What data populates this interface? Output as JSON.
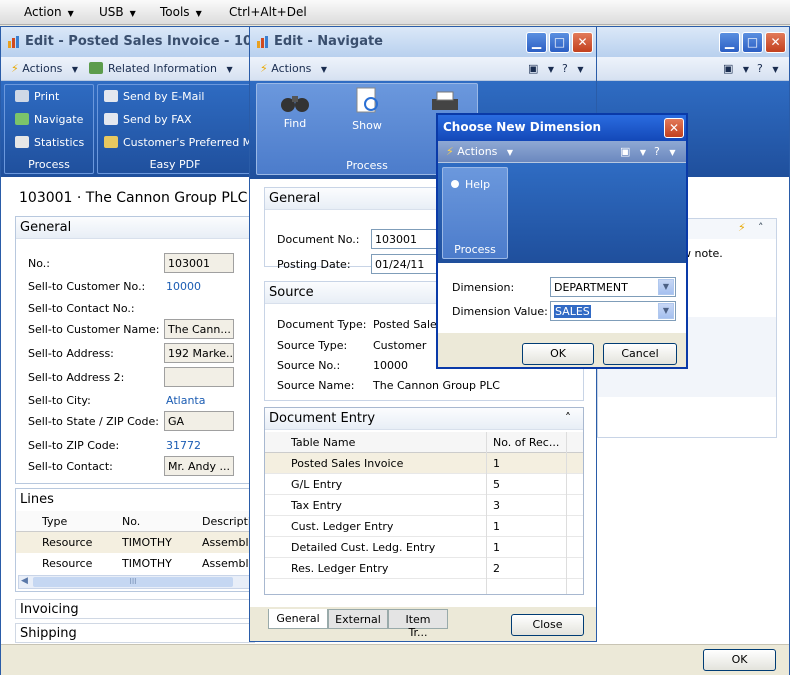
{
  "host_menu": {
    "action": "Action",
    "usb": "USB",
    "tools": "Tools",
    "cad": "Ctrl+Alt+Del"
  },
  "invoice_window": {
    "title": "Edit - Posted Sales Invoice - 103001",
    "actions": "Actions",
    "related": "Related Information",
    "ribbon": {
      "process": {
        "label": "Process",
        "items": [
          "Print",
          "Navigate",
          "Statistics"
        ]
      },
      "easy_pdf": {
        "label": "Easy PDF",
        "items": [
          "Send by E-Mail",
          "Send by FAX",
          "Customer's Preferred Met"
        ]
      }
    },
    "heading": "103001 · The Cannon Group PLC",
    "general": {
      "title": "General",
      "fields": [
        {
          "label": "No.:",
          "value": "103001",
          "kind": "box"
        },
        {
          "label": "Sell-to Customer No.:",
          "value": "10000",
          "kind": "link"
        },
        {
          "label": "Sell-to Contact No.:",
          "value": "",
          "kind": "none"
        },
        {
          "label": "Sell-to Customer Name:",
          "value": "The Cann...",
          "kind": "box"
        },
        {
          "label": "Sell-to Address:",
          "value": "192 Marke...",
          "kind": "box"
        },
        {
          "label": "Sell-to Address 2:",
          "value": "",
          "kind": "box"
        },
        {
          "label": "Sell-to City:",
          "value": "Atlanta",
          "kind": "link"
        },
        {
          "label": "Sell-to State / ZIP Code:",
          "value": "GA",
          "kind": "box"
        },
        {
          "label": "Sell-to ZIP Code:",
          "value": "31772",
          "kind": "link"
        },
        {
          "label": "Sell-to Contact:",
          "value": "Mr. Andy ...",
          "kind": "box"
        }
      ]
    },
    "lines": {
      "title": "Lines",
      "columns": [
        "Type",
        "No.",
        "Descriptio"
      ],
      "rows": [
        [
          "Resource",
          "TIMOTHY",
          "Assemblin"
        ],
        [
          "Resource",
          "TIMOTHY",
          "Assemblin"
        ]
      ],
      "scroll_arrow": "◀",
      "scroll_grip": "III"
    },
    "invoicing": "Invoicing",
    "shipping": "Shipping",
    "note_text": "w note.",
    "ok": "OK"
  },
  "navigate_window": {
    "title": "Edit - Navigate",
    "actions": "Actions",
    "ribbon": {
      "label": "Process",
      "items": [
        "Find",
        "Show",
        "P"
      ]
    },
    "general": {
      "title": "General",
      "fields": [
        {
          "label": "Document No.:",
          "value": "103001"
        },
        {
          "label": "Posting Date:",
          "value": "01/24/11"
        }
      ]
    },
    "source": {
      "title": "Source",
      "fields": [
        {
          "label": "Document Type:",
          "value": "Posted Sales"
        },
        {
          "label": "Source Type:",
          "value": "Customer"
        },
        {
          "label": "Source No.:",
          "value": "10000"
        },
        {
          "label": "Source Name:",
          "value": "The Cannon Group PLC"
        }
      ]
    },
    "doc_entry": {
      "title": "Document Entry",
      "columns": [
        "Table Name",
        "No. of Rec..."
      ],
      "rows": [
        [
          "Posted Sales Invoice",
          "1"
        ],
        [
          "G/L Entry",
          "5"
        ],
        [
          "Tax Entry",
          "3"
        ],
        [
          "Cust. Ledger Entry",
          "1"
        ],
        [
          "Detailed Cust. Ledg. Entry",
          "1"
        ],
        [
          "Res. Ledger Entry",
          "2"
        ]
      ]
    },
    "tabs": [
      "General",
      "External",
      "Item Tr..."
    ],
    "close": "Close"
  },
  "dimension_dialog": {
    "title": "Choose New Dimension",
    "actions": "Actions",
    "help": "Help",
    "process": "Process",
    "dimension_label": "Dimension:",
    "dimension_value": "DEPARTMENT",
    "value_label": "Dimension Value:",
    "value_value": "SALES",
    "ok": "OK",
    "cancel": "Cancel"
  },
  "colors": {
    "ribbon": "#2f6cc3",
    "title_bar": "#c8dbf2",
    "link": "#1c5db3",
    "close_btn": "#d9562f"
  }
}
